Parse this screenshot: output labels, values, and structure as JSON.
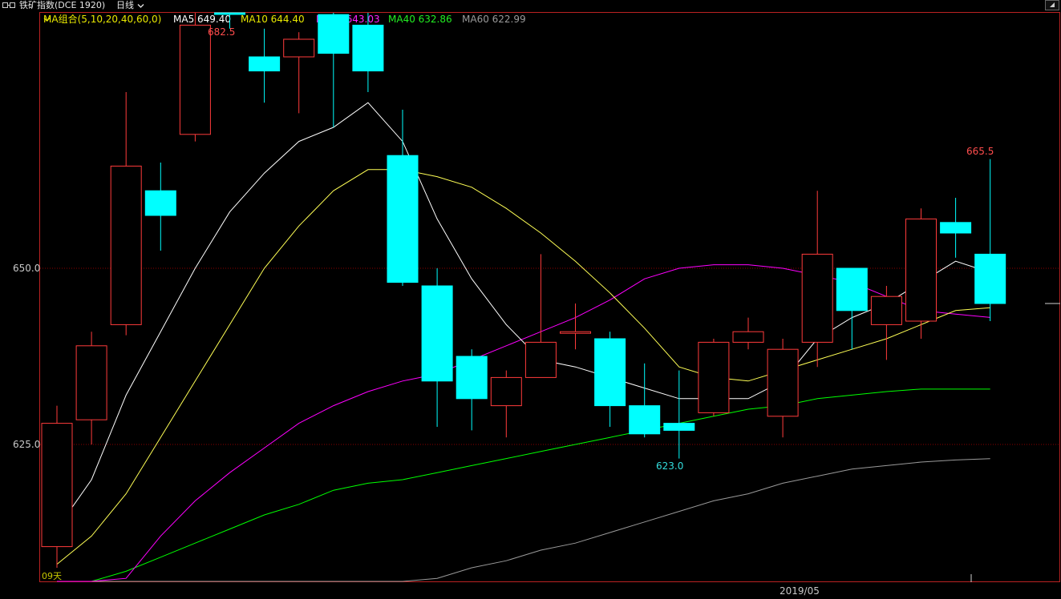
{
  "header": {
    "symbol_title": "铁矿指数(DCE 1920)",
    "period": "日线",
    "period_chevron": "chevron-down-icon"
  },
  "ma_legend": {
    "combo": "MA组合(5,10,20,40,60,0)",
    "ma5": "MA5 649.40",
    "ma10": "MA10 644.40",
    "ma20": "MA20 643.03",
    "ma40": "MA40 632.86",
    "ma60": "MA60 622.99"
  },
  "axis": {
    "y_ticks": [
      "650.0",
      "625.0"
    ],
    "x_label": "2019/05",
    "bottom_text": "09天"
  },
  "annotations": {
    "high": "682.5",
    "recent_high": "665.5",
    "low": "623.0"
  },
  "colors": {
    "up": "#ff3b3b",
    "down": "#00ffff",
    "ma5": "#ffffff",
    "ma10": "#ffff55",
    "ma20": "#ff00ff",
    "ma40": "#00ff00",
    "ma60": "#9a9a9a",
    "grid": "#8b0000"
  },
  "chart_data": {
    "type": "candlestick",
    "y_range": [
      610.0,
      687.0
    ],
    "candles": [
      {
        "o": 610.5,
        "c": 628.0,
        "h": 630.5,
        "l": 607.5
      },
      {
        "o": 628.5,
        "c": 639.0,
        "h": 641.0,
        "l": 625.0
      },
      {
        "o": 642.0,
        "c": 664.5,
        "h": 675.0,
        "l": 640.5
      },
      {
        "o": 661.0,
        "c": 657.5,
        "h": 665.0,
        "l": 652.5
      },
      {
        "o": 669.0,
        "c": 684.5,
        "h": 692.5,
        "l": 668.0
      },
      {
        "o": 698.0,
        "c": 688.0,
        "h": 692.0,
        "l": 684.0
      },
      {
        "o": 680.0,
        "c": 678.0,
        "h": 684.0,
        "l": 673.5
      },
      {
        "o": 680.0,
        "c": 682.5,
        "h": 683.5,
        "l": 672.0
      },
      {
        "o": 686.0,
        "c": 680.5,
        "h": 689.5,
        "l": 670.0
      },
      {
        "o": 684.5,
        "c": 678.0,
        "h": 688.0,
        "l": 675.0
      },
      {
        "o": 666.0,
        "c": 648.0,
        "h": 672.5,
        "l": 647.5
      },
      {
        "o": 647.5,
        "c": 634.0,
        "h": 650.0,
        "l": 627.5
      },
      {
        "o": 637.5,
        "c": 631.5,
        "h": 638.5,
        "l": 627.0
      },
      {
        "o": 630.5,
        "c": 634.5,
        "h": 635.5,
        "l": 626.0
      },
      {
        "o": 634.5,
        "c": 639.5,
        "h": 652.0,
        "l": 634.5
      },
      {
        "o": 641.0,
        "c": 641.0,
        "h": 645.0,
        "l": 638.5
      },
      {
        "o": 640.0,
        "c": 630.5,
        "h": 641.0,
        "l": 627.5
      },
      {
        "o": 630.5,
        "c": 626.5,
        "h": 636.5,
        "l": 626.0
      },
      {
        "o": 628.0,
        "c": 627.0,
        "h": 635.5,
        "l": 623.0
      },
      {
        "o": 629.5,
        "c": 639.5,
        "h": 640.0,
        "l": 629.0
      },
      {
        "o": 639.5,
        "c": 641.0,
        "h": 643.0,
        "l": 638.5
      },
      {
        "o": 629.0,
        "c": 638.5,
        "h": 640.0,
        "l": 626.0
      },
      {
        "o": 639.5,
        "c": 652.0,
        "h": 661.0,
        "l": 636.0
      },
      {
        "o": 650.0,
        "c": 644.0,
        "h": 650.0,
        "l": 638.5
      },
      {
        "o": 642.0,
        "c": 646.0,
        "h": 647.5,
        "l": 637.0
      },
      {
        "o": 642.5,
        "c": 657.0,
        "h": 658.5,
        "l": 640.0
      },
      {
        "o": 656.5,
        "c": 655.0,
        "h": 660.0,
        "l": 651.5
      },
      {
        "o": 652.0,
        "c": 645.0,
        "h": 665.5,
        "l": 642.5
      }
    ],
    "ma5": [
      613.0,
      620.0,
      632.0,
      641.0,
      650.0,
      658.0,
      663.5,
      668.0,
      670.0,
      673.5,
      668.0,
      657.0,
      648.5,
      642.0,
      637.0,
      636.0,
      634.5,
      633.0,
      631.5,
      631.5,
      631.5,
      634.0,
      640.0,
      643.0,
      645.0,
      648.0,
      651.0,
      649.4
    ],
    "ma10": [
      608.0,
      612.0,
      618.0,
      626.0,
      634.0,
      642.0,
      650.0,
      656.0,
      661.0,
      664.0,
      664.0,
      663.0,
      661.5,
      658.5,
      655.0,
      651.0,
      646.5,
      641.5,
      636.0,
      634.5,
      634.0,
      635.5,
      637.0,
      638.5,
      640.0,
      642.0,
      644.0,
      644.4
    ],
    "ma20": [
      600.0,
      602.0,
      606.0,
      612.0,
      617.0,
      621.0,
      624.5,
      628.0,
      630.5,
      632.5,
      634.0,
      635.0,
      637.0,
      639.0,
      641.0,
      643.0,
      645.5,
      648.5,
      650.0,
      650.5,
      650.5,
      650.0,
      649.0,
      648.0,
      646.0,
      644.0,
      643.5,
      643.03
    ],
    "ma40": [
      603.0,
      605.0,
      607.0,
      609.0,
      611.0,
      613.0,
      615.0,
      616.5,
      618.5,
      619.5,
      620.0,
      621.0,
      622.0,
      623.0,
      624.0,
      625.0,
      626.0,
      627.0,
      628.0,
      629.0,
      630.0,
      630.5,
      631.5,
      632.0,
      632.5,
      632.86,
      632.86,
      632.86
    ],
    "ma60": [
      596.0,
      596.0,
      596.0,
      597.0,
      598.0,
      599.0,
      600.5,
      601.5,
      602.5,
      603.5,
      605.0,
      606.0,
      607.5,
      608.5,
      610.0,
      611.0,
      612.5,
      614.0,
      615.5,
      617.0,
      618.0,
      619.5,
      620.5,
      621.5,
      622.0,
      622.5,
      622.8,
      622.99
    ],
    "xlabel": "",
    "ylabel": ""
  }
}
